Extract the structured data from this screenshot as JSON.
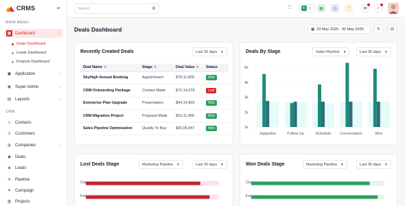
{
  "brand": {
    "name": "CRMS"
  },
  "sidebar": {
    "main_menu_title": "MAIN MENU",
    "crm_title": "CRM",
    "dashboard": {
      "label": "Dashboard"
    },
    "sub_items": [
      {
        "label": "Deals Dashboard"
      },
      {
        "label": "Leads Dashboard"
      },
      {
        "label": "Projects Dashboard"
      }
    ],
    "main_items": [
      {
        "label": "Application"
      },
      {
        "label": "Super Admin"
      },
      {
        "label": "Layouts"
      }
    ],
    "crm_items": [
      {
        "label": "Contacts"
      },
      {
        "label": "Customers"
      },
      {
        "label": "Companies"
      },
      {
        "label": "Deals"
      },
      {
        "label": "Leads"
      },
      {
        "label": "Pipeline"
      },
      {
        "label": "Campaign"
      },
      {
        "label": "Projects"
      }
    ]
  },
  "topbar": {
    "search_placeholder": "Search",
    "search_shortcut": "⌘"
  },
  "page": {
    "title": "Deals Dashboard",
    "date_range": "23 May 2025 - 30 May 2025"
  },
  "recent_deals": {
    "title": "Recently Created Deals",
    "filter": "Last 30 days",
    "columns": [
      "Deal Name",
      "Stage",
      "Deal Value",
      "Status"
    ],
    "rows": [
      {
        "name": "SkyHigh Annual Booking",
        "stage": "Appointment",
        "value": "$78,11,800",
        "status": "Won"
      },
      {
        "name": "CRM Onboarding Package",
        "stage": "Contact Made",
        "value": "$72,14,078",
        "status": "Lost"
      },
      {
        "name": "Enterprise Plan Upgrade",
        "stage": "Presentation",
        "value": "$04,14,800",
        "status": "Won"
      },
      {
        "name": "CRM Migration Project",
        "stage": "Proposal Made",
        "value": "$16,11,400",
        "status": "Won"
      },
      {
        "name": "Sales Pipeline Optimization",
        "stage": "Quality To Buy",
        "value": "$09,05,947",
        "status": "Won"
      }
    ],
    "status_colors": {
      "Won": "#2e9d5b",
      "Lost": "#e02424"
    }
  },
  "deals_by_stage": {
    "title": "Deals By Stage",
    "pipeline_filter": "Sales Pipeline",
    "filter": "Last 30 days"
  },
  "lost_deals": {
    "title": "Lost Deals Stage",
    "pipeline_filter": "Marketing Pipeline",
    "filter": "Last 30 days"
  },
  "won_deals": {
    "title": "Won Deals Stage",
    "pipeline_filter": "Marketing Pipeline",
    "filter": "Last 30 days"
  },
  "chart_data": [
    {
      "type": "bar",
      "title": "Deals By Stage",
      "categories": [
        "Inpipeline",
        "Follow Up",
        "Schedule",
        "Conversation",
        "Won"
      ],
      "ylim": [
        1000,
        5000
      ],
      "yticks": [
        "1k",
        "2k",
        "3k",
        "4k",
        "5k"
      ],
      "series": [
        {
          "values": [
            2700,
            2700,
            2600,
            2700,
            2700
          ],
          "color": "#e6faf7"
        },
        {
          "values": [
            4550,
            2600,
            3850,
            5300,
            4900
          ],
          "color": "#1f8a78"
        },
        {
          "values": [
            2750,
            2700,
            2700,
            2700,
            2700
          ],
          "color": "#2f6d7c"
        }
      ]
    },
    {
      "type": "bar",
      "title": "Lost Deals Stage",
      "orientation": "horizontal",
      "categories": [
        "Conversation",
        "Follow Up"
      ],
      "values": [
        0.86,
        0.93
      ],
      "track_color": "#fde2e8",
      "bar_color": "#c0272d"
    },
    {
      "type": "bar",
      "title": "Won Deals Stage",
      "orientation": "horizontal",
      "categories": [
        "Conversation",
        "Follow Up"
      ],
      "values": [
        0.89,
        0.95
      ],
      "track_color": "#e3f5ec",
      "bar_color": "#2e9d5b"
    }
  ]
}
